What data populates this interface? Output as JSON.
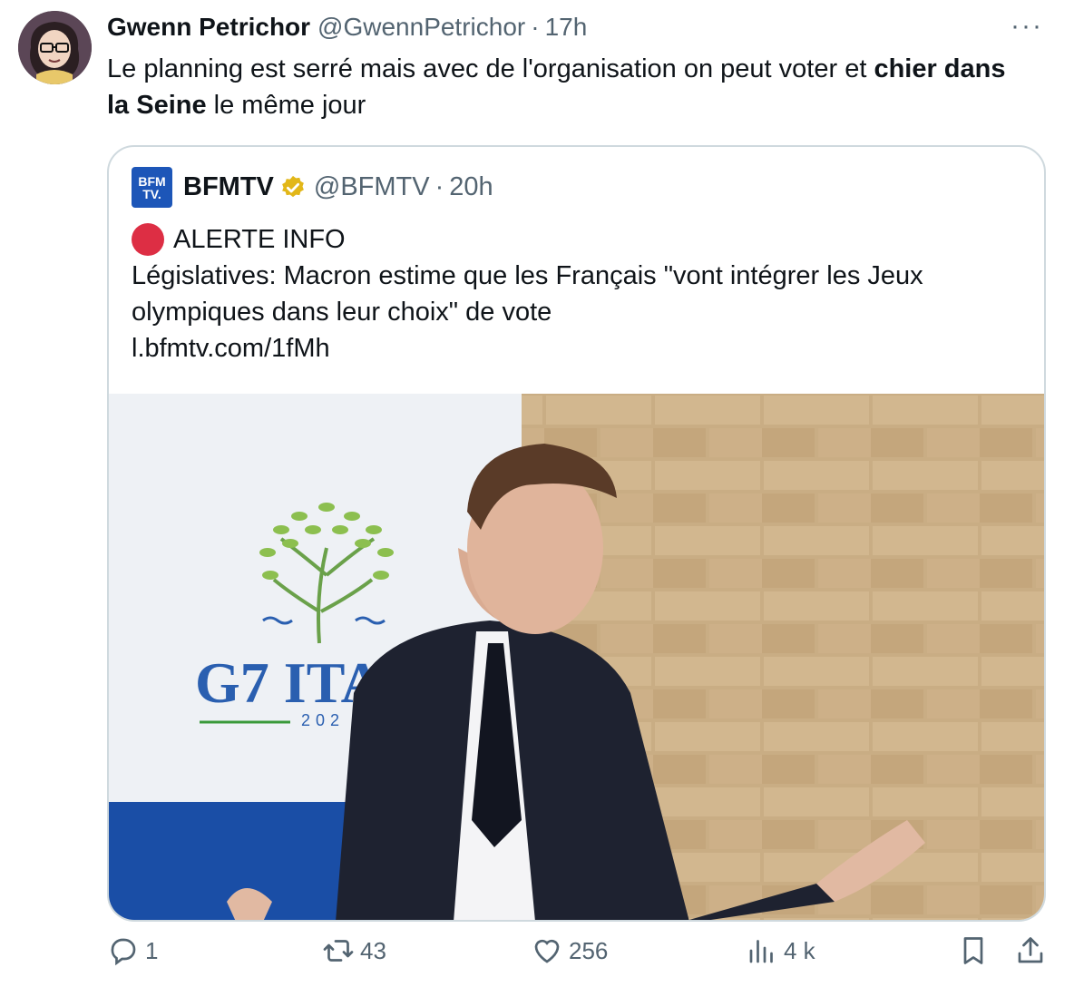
{
  "tweet": {
    "author_name": "Gwenn Petrichor",
    "author_handle": "@GwennPetrichor",
    "separator": "·",
    "time": "17h",
    "text_part1": "Le planning est serré mais avec de l'organisation on peut voter et ",
    "text_bold": "chier dans la Seine",
    "text_part2": " le même jour",
    "more_label": "···"
  },
  "quote": {
    "logo_line1": "BFM",
    "logo_line2": "TV.",
    "name": "BFMTV",
    "handle": "@BFMTV",
    "separator": "·",
    "time": "20h",
    "alert": "ALERTE INFO",
    "body": "Législatives: Macron estime que les Français \"vont intégrer les Jeux olympiques dans leur choix\" de vote",
    "link": "l.bfmtv.com/1fMh",
    "image_sign_text": "G7 ITALI",
    "image_sign_year": "202"
  },
  "actions": {
    "replies": "1",
    "reposts": "43",
    "likes": "256",
    "views": "4 k"
  },
  "colors": {
    "accent": "#1d9bf0",
    "muted": "#536471",
    "border": "#cfd9de",
    "alert_red": "#dd2e44",
    "bfm_blue": "#1d56b8",
    "verified_gold": "#e2b719"
  }
}
